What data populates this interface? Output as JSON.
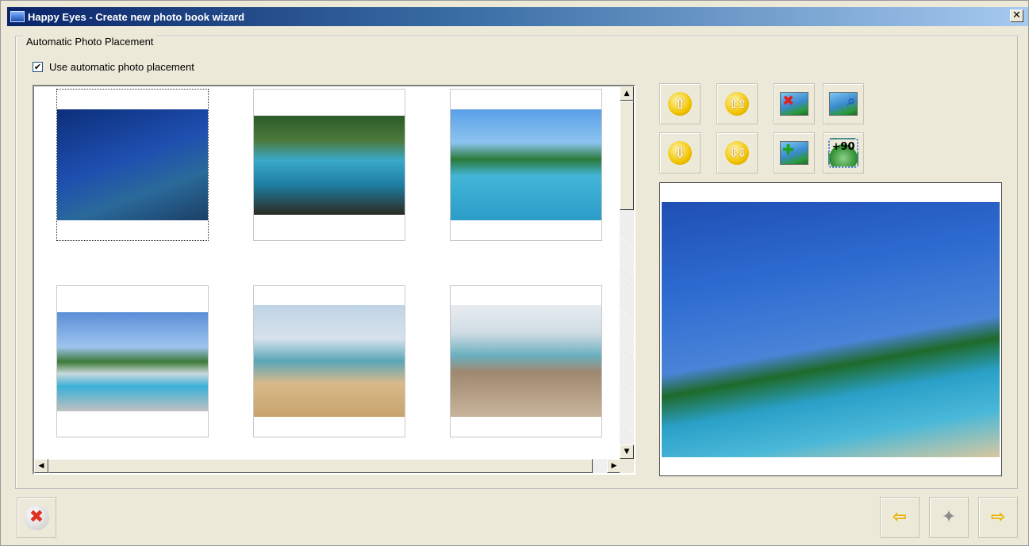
{
  "window": {
    "title": "Happy Eyes - Create new photo book wizard",
    "close_glyph": "✕"
  },
  "group": {
    "legend": "Automatic Photo Placement"
  },
  "auto_placement": {
    "checked": true,
    "check_glyph": "✔",
    "label": "Use automatic photo placement"
  },
  "photos": [
    {
      "name": "palm-boat",
      "selected": true
    },
    {
      "name": "flamingos",
      "selected": false
    },
    {
      "name": "pool-palms",
      "selected": false
    },
    {
      "name": "resort-pool",
      "selected": false
    },
    {
      "name": "sandcastle",
      "selected": false
    },
    {
      "name": "family-beach",
      "selected": false
    }
  ],
  "scrollbar": {
    "up_glyph": "▲",
    "down_glyph": "▼",
    "left_glyph": "◀",
    "right_glyph": "▶"
  },
  "toolbar": {
    "move_up_glyph": "⇧",
    "move_first_glyph": "⇧⇧",
    "move_down_glyph": "⇩",
    "move_last_glyph": "⇩⇩",
    "remove_glyph": "✖",
    "add_glyph": "✚",
    "zoom_glyph": "⌕",
    "rotate_label": "+90"
  },
  "preview": {
    "photo": "palm-boat"
  },
  "footer": {
    "cancel_glyph": "✖",
    "back_glyph": "⇦",
    "finish_glyph": "✦",
    "next_glyph": "⇨"
  }
}
